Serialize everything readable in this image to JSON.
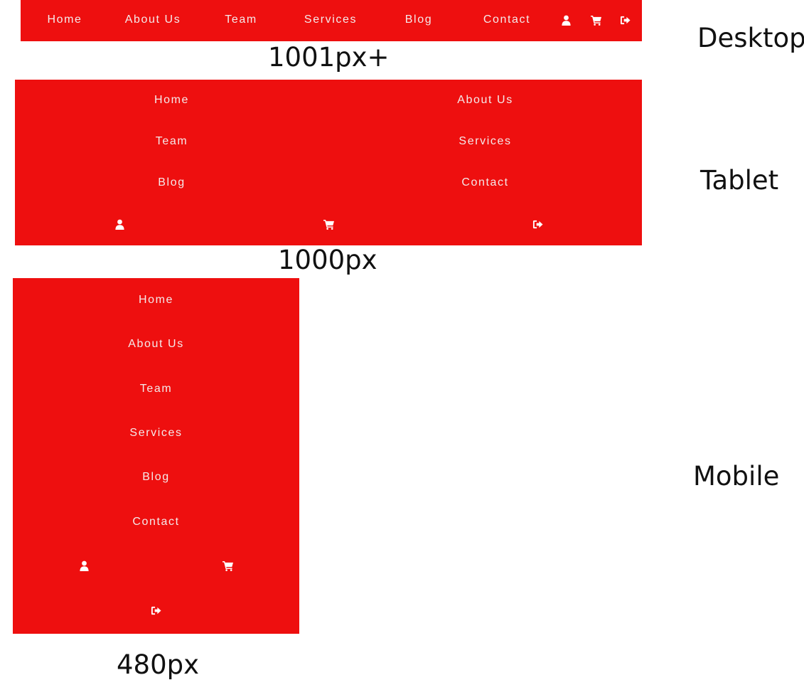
{
  "nav_items": [
    "Home",
    "About Us",
    "Team",
    "Services",
    "Blog",
    "Contact"
  ],
  "icons": [
    "user-icon",
    "cart-icon",
    "sign-out-icon"
  ],
  "colors": {
    "nav_background": "#ee0f0f",
    "nav_text": "#f4eaea",
    "label_text": "#111111"
  },
  "labels": {
    "desktop": "Desktop",
    "desktop_breakpoint": "1001px+",
    "tablet": "Tablet",
    "tablet_breakpoint": "1000px",
    "mobile": "Mobile",
    "mobile_breakpoint": "480px"
  }
}
